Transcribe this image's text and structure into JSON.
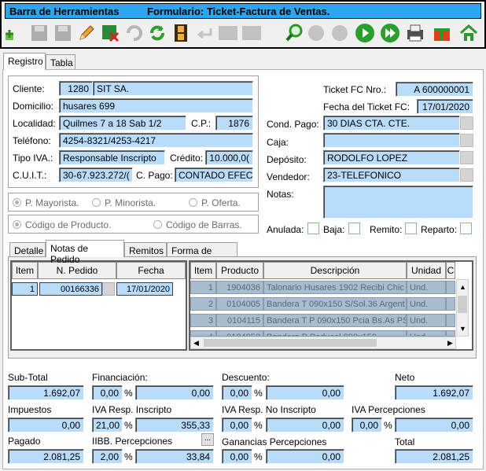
{
  "toolbar": {
    "title_left": "Barra de Herramientas",
    "title_right": "Formulario: Ticket-Factura de Ventas."
  },
  "tabs": {
    "registro": "Registro",
    "tabla": "Tabla"
  },
  "cliente": {
    "label": "Cliente:",
    "code": "1280",
    "name": "SIT SA.",
    "domicilio_label": "Domicilio:",
    "domicilio": "husares  699",
    "localidad_label": "Localidad:",
    "localidad": "Quilmes 7 a 18 Sab 1/2",
    "cp_label": "C.P.:",
    "cp": "1876",
    "telefono_label": "Teléfono:",
    "telefono": "4254-8321/4253-4217",
    "tipo_iva_label": "Tipo IVA.:",
    "tipo_iva": "Responsable Inscripto",
    "credito_label": "Crédito:",
    "credito": "10.000,0(",
    "cuit_label": "C.U.I.T.:",
    "cuit": "30-67.923.272/(",
    "cpago_label": "C. Pago:",
    "cpago": "CONTADO EFEC"
  },
  "ticket": {
    "nro_label": "Ticket FC Nro.:",
    "nro": "A  600000001",
    "fecha_label": "Fecha del Ticket FC:",
    "fecha": "17/01/2020",
    "cond_pago_label": "Cond. Pago:",
    "cond_pago": "30 DIAS CTA. CTE.",
    "caja_label": "Caja:",
    "caja": "",
    "deposito_label": "Depósito:",
    "deposito": "RODOLFO LOPEZ",
    "vendedor_label": "Vendedor:",
    "vendedor": "23-TELEFONICO",
    "notas_label": "Notas:",
    "notas": ""
  },
  "precios": {
    "mayorista": "P. Mayorista.",
    "minorista": "P. Minorista.",
    "oferta": "P. Oferta."
  },
  "codigos": {
    "producto": "Código de Producto.",
    "barras": "Código de Barras."
  },
  "flags": {
    "anulada": "Anulada:",
    "baja": "Baja:",
    "remito": "Remito:",
    "reparto": "Reparto:"
  },
  "subtabs": {
    "detalle": "Detalle",
    "notas": "Notas de Pedido",
    "remitos": "Remitos",
    "forma_pago": "Forma de Pago"
  },
  "pedidos": {
    "headers": [
      "Item",
      "N. Pedido",
      "Fecha"
    ],
    "rows": [
      [
        "1",
        "00166336",
        "17/01/2020"
      ]
    ]
  },
  "productos": {
    "headers": [
      "Item",
      "Producto",
      "Descripción",
      "Unidad",
      "C"
    ],
    "rows": [
      [
        "1",
        "1904036",
        "Talonario Husares 1902 Recibi Chic",
        "Und."
      ],
      [
        "2",
        "0104005",
        "Bandera T 090x150 S/Sol.36 Argent",
        "Und."
      ],
      [
        "3",
        "0104115",
        "Bandera T P 090x150 Pcia Bs.As PS",
        "Und."
      ],
      [
        "4",
        "0104052",
        "Bandera P Poducol 090x150",
        "Und."
      ]
    ]
  },
  "totales": {
    "subtotal_label": "Sub-Total",
    "subtotal": "1.692,07",
    "financiacion_label": "Financiación:",
    "fin_pct": "0,00",
    "fin_val": "0,00",
    "descuento_label": "Descuento:",
    "desc_pct": "0,00",
    "desc_val": "0,00",
    "neto_label": "Neto",
    "neto": "1.692,07",
    "impuestos_label": "Impuestos",
    "impuestos": "0,00",
    "iva_ri_label": "IVA Resp. Inscripto",
    "iva_ri_pct": "21,00",
    "iva_ri_val": "355,33",
    "iva_rni_label": "IVA Resp. No Inscripto",
    "iva_rni_pct": "0,00",
    "iva_rni_val": "0,00",
    "iva_perc_label": "IVA Percepciones",
    "iva_perc_pct": "0,00",
    "iva_perc_val": "0,00",
    "pagado_label": "Pagado",
    "pagado": "2.081,25",
    "iibb_label": "IIBB. Percepciones",
    "iibb_pct": "2,00",
    "iibb_val": "33,84",
    "ganancias_label": "Ganancias Percepciones",
    "gan_pct": "0,00",
    "gan_val": "0,00",
    "total_label": "Total",
    "total": "2.081,25",
    "pct_sign": "%",
    "ellipsis": "..."
  }
}
